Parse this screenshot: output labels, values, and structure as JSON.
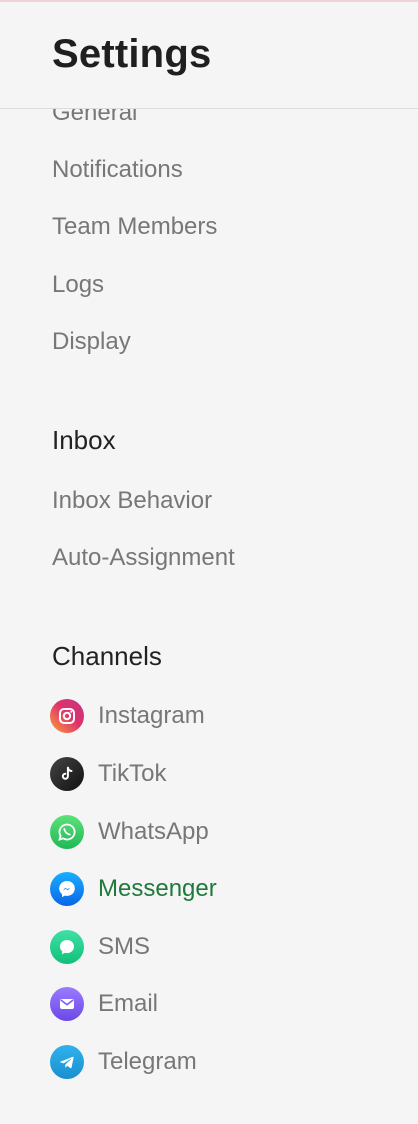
{
  "header": {
    "title": "Settings"
  },
  "general_items": [
    "General",
    "Notifications",
    "Team Members",
    "Logs",
    "Display"
  ],
  "inbox": {
    "heading": "Inbox",
    "items": [
      "Inbox Behavior",
      "Auto-Assignment"
    ]
  },
  "channels": {
    "heading": "Channels",
    "items": [
      {
        "label": "Instagram",
        "icon": "instagram-icon",
        "color": "#e1306c"
      },
      {
        "label": "TikTok",
        "icon": "tiktok-icon",
        "color": "#222222"
      },
      {
        "label": "WhatsApp",
        "icon": "whatsapp-icon",
        "color": "#25d366"
      },
      {
        "label": "Messenger",
        "icon": "messenger-icon",
        "color": "#1877f2",
        "active": true
      },
      {
        "label": "SMS",
        "icon": "sms-icon",
        "color": "#1ed08a"
      },
      {
        "label": "Email",
        "icon": "email-icon",
        "color": "#7c5cf0"
      },
      {
        "label": "Telegram",
        "icon": "telegram-icon",
        "color": "#229ed9"
      }
    ]
  },
  "accent_color": "#1e7a3c"
}
